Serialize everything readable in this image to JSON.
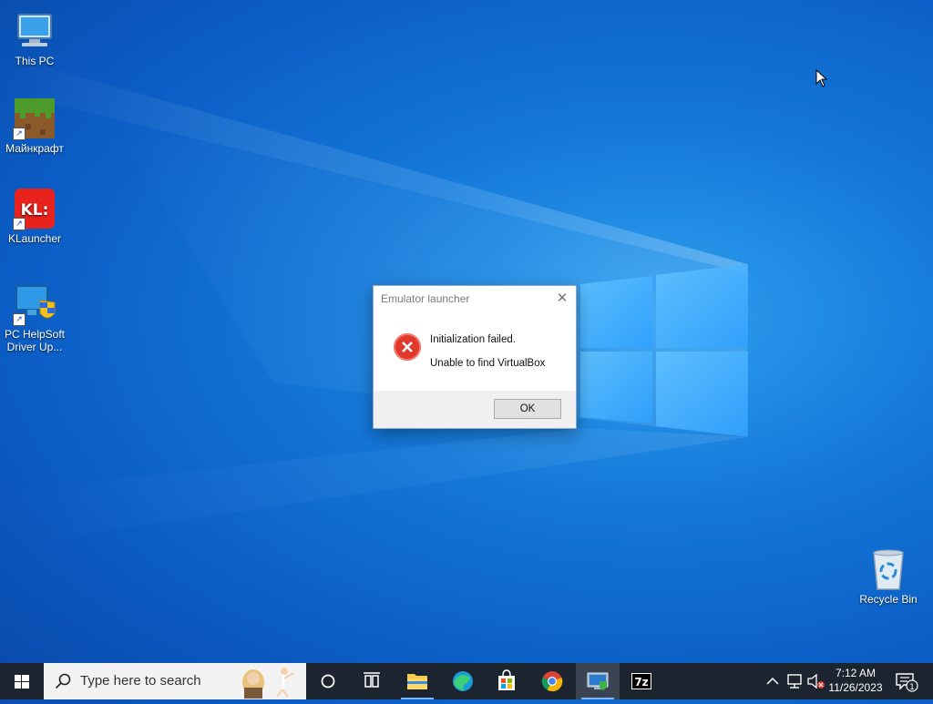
{
  "desktop": {
    "icons": [
      {
        "label": "This PC",
        "icon": "this-pc-icon"
      },
      {
        "label": "Майнкрафт",
        "icon": "minecraft-icon"
      },
      {
        "label": "KLauncher",
        "icon": "klauncher-icon",
        "badge_text": "KL:"
      },
      {
        "label": "PC HelpSoft Driver Up...",
        "icon": "driver-updater-icon"
      },
      {
        "label": "Recycle Bin",
        "icon": "recycle-bin-icon"
      }
    ]
  },
  "dialog": {
    "title": "Emulator launcher",
    "close_glyph": "✕",
    "message_line1": "Initialization failed.",
    "message_line2": "Unable to find VirtualBox",
    "ok_label": "OK",
    "icon": "error-icon"
  },
  "taskbar": {
    "search_placeholder": "Type here to search",
    "apps": [
      "cortana-icon",
      "task-view-icon",
      "file-explorer-icon",
      "edge-icon",
      "store-icon",
      "chrome-icon",
      "emulator-app-icon",
      "7zip-icon"
    ],
    "seven_zip_text": "7z",
    "time": "7:12 AM",
    "date": "11/26/2023",
    "notification_count": "1"
  },
  "colors": {
    "desktop_blue": "#0b5cc4",
    "taskbar": "#1c2430",
    "error_red": "#e0392b"
  }
}
